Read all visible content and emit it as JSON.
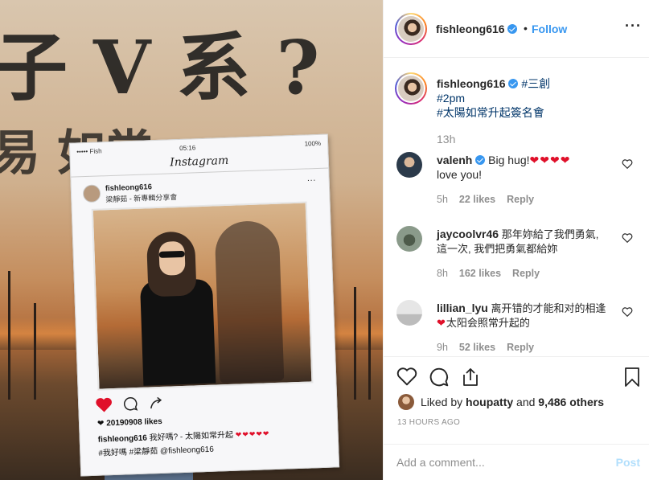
{
  "photo": {
    "frame": {
      "carrier": "••••• Fish",
      "clock": "05:16",
      "battery": "100%",
      "app_name": "Instagram",
      "username": "fishleong616",
      "location": "梁靜茹 - 新專輯分享會",
      "likes": "20190908 likes",
      "caption_user": "fishleong616",
      "caption_text": "我好嗎? - 太陽如常升起",
      "caption_hearts": "❤❤❤❤❤",
      "caption_tags": "#我好嗎 #梁靜茹 @fishleong616"
    }
  },
  "header": {
    "username": "fishleong616",
    "separator": "•",
    "follow_label": "Follow",
    "more_label": "···"
  },
  "caption": {
    "username": "fishleong616",
    "line1_tag": "#三創",
    "line2_tag": "#2pm",
    "line3_tag": "#太陽如常升起簽名會",
    "time": "13h"
  },
  "comments": [
    {
      "username": "valenh",
      "verified": true,
      "text": "Big hug!",
      "hearts": "❤❤❤❤",
      "text2": "love you!",
      "time": "5h",
      "likes": "22 likes",
      "reply": "Reply"
    },
    {
      "username": "jaycoolvr46",
      "verified": false,
      "text": "那年妳給了我們勇氣,",
      "text2": "這一次, 我們把勇氣都給妳",
      "time": "8h",
      "likes": "162 likes",
      "reply": "Reply"
    },
    {
      "username": "lillian_lyu",
      "verified": false,
      "text": "离开错的才能和对的相逢",
      "hearts": "❤",
      "text2": "太阳会照常升起的",
      "time": "9h",
      "likes": "52 likes",
      "reply": "Reply"
    }
  ],
  "actions": {
    "liked_by_prefix": "Liked by",
    "liked_by_user": "houpatty",
    "liked_by_and": "and",
    "liked_by_others": "9,486 others",
    "time_ago": "13 HOURS AGO"
  },
  "comment_box": {
    "placeholder": "Add a comment...",
    "post_label": "Post"
  },
  "colors": {
    "link_blue": "#3897f0",
    "tag_blue": "#003569",
    "heart_red": "#e0102a",
    "muted": "#8e8e8e",
    "post_disabled": "#b2dffc"
  }
}
